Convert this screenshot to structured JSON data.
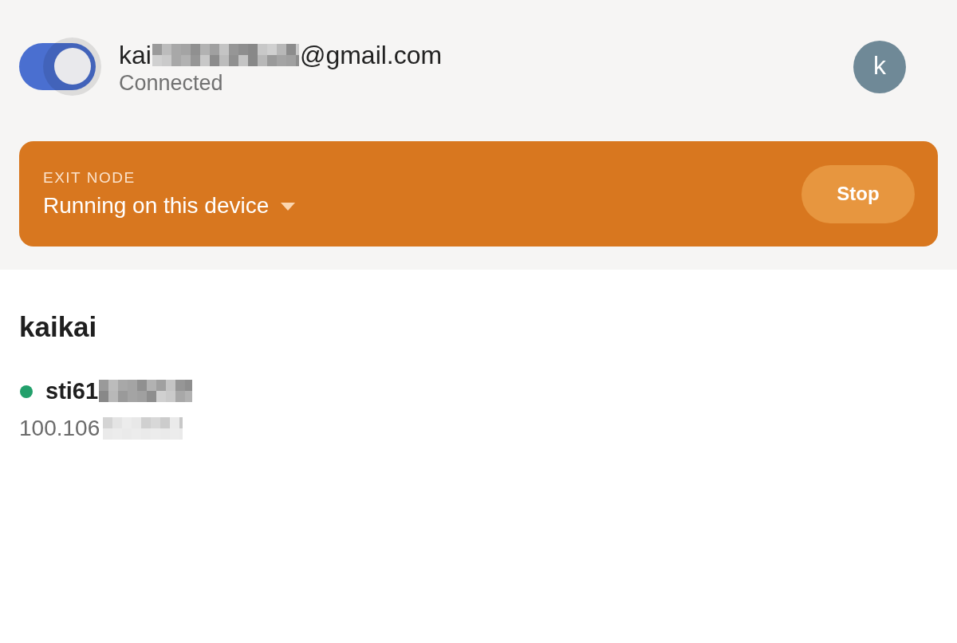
{
  "header": {
    "connection_toggle": {
      "on": true
    },
    "account": {
      "email_start": "kai",
      "email_redacted": true,
      "email_end": "@gmail.com",
      "status": "Connected"
    },
    "avatar": {
      "initial": "k"
    }
  },
  "exit_node": {
    "label": "EXIT NODE",
    "value": "Running on this device",
    "button": "Stop"
  },
  "network": {
    "name": "kaikai",
    "devices": [
      {
        "name": "sti61",
        "name_redacted": true,
        "address": "100.106",
        "address_redacted": true,
        "online": true
      }
    ]
  }
}
